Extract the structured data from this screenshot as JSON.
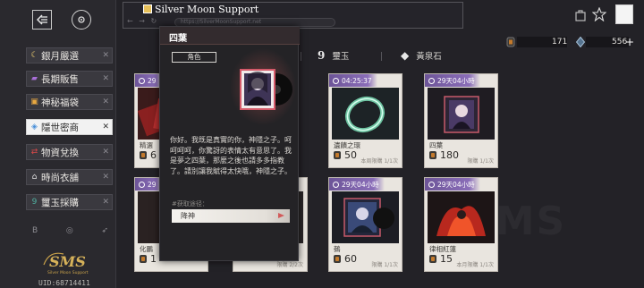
{
  "window": {
    "title": "Silver Moon Support",
    "url": "https://SilverMoonSupport.net"
  },
  "sidebar": {
    "items": [
      {
        "label": "銀月嚴選",
        "icon": "crescent-moon-icon",
        "icon_color": "#f0d070"
      },
      {
        "label": "長期販售",
        "icon": "folder-icon",
        "icon_color": "#a86fd8"
      },
      {
        "label": "神秘福袋",
        "icon": "gift-bag-icon",
        "icon_color": "#e8a840"
      },
      {
        "label": "隱世密商",
        "icon": "cube-icon",
        "icon_color": "#4a90d9"
      },
      {
        "label": "物資兌換",
        "icon": "swap-icon",
        "icon_color": "#d84848"
      },
      {
        "label": "時尚衣舖",
        "icon": "hanger-icon",
        "icon_color": "#e0e0e0"
      },
      {
        "label": "璽玉採購",
        "icon": "jade-icon",
        "icon_color": "#50b0a0"
      }
    ],
    "active_index": 3,
    "bottom_icons": [
      "B",
      "◎",
      "➶"
    ],
    "uid": "UID:68714411",
    "logo_text": "SMS",
    "logo_subtext": "Silver Moon Support"
  },
  "currency": {
    "coin": {
      "value": "171",
      "icon": "coin-icon"
    },
    "crystal": {
      "value": "556",
      "icon": "diamond-icon",
      "plus": "+"
    }
  },
  "tabs": [
    {
      "label": "璽玉",
      "icon_glyph": "9"
    },
    {
      "label": "黃泉石",
      "icon_glyph": "◆"
    }
  ],
  "cards": [
    {
      "timer": "29",
      "name": "精選",
      "price": "6",
      "limit": ""
    },
    {
      "timer": "04:25:37",
      "name": "遺饋之環",
      "price": "50",
      "limit": "本周限購 1/1次"
    },
    {
      "timer": "29天04小時",
      "name": "四葉",
      "price": "180",
      "limit": "限購 1/1次"
    },
    {
      "timer": "29",
      "name": "化鵬",
      "price": "1",
      "limit": "限購 2/2次"
    },
    {
      "timer": "29天04小時",
      "name": "鵺",
      "price": "60",
      "limit": "限購 1/1次"
    },
    {
      "timer": "29天04小時",
      "name": "律相紅蓮",
      "price": "15",
      "limit": "本月限購 1/1次"
    }
  ],
  "card_extra_limit": "限購 2/2次",
  "popup": {
    "title": "四葉",
    "tag": "角色",
    "description": "你好。我既是真實的你，神隱之子。呵呵呵呵，你驚訝的表情太有意思了。我是夢之四葉，那麼之後也請多多指教了。請別讓我賦得太快哦，神隱之子。",
    "source_label": "#获取途径：",
    "source_button": "降神"
  },
  "watermark": "SMS",
  "colors": {
    "timer_bar": "#7a5fa8",
    "accent_red": "#d25a5a",
    "active_item_bg": "#f2f2f2"
  }
}
